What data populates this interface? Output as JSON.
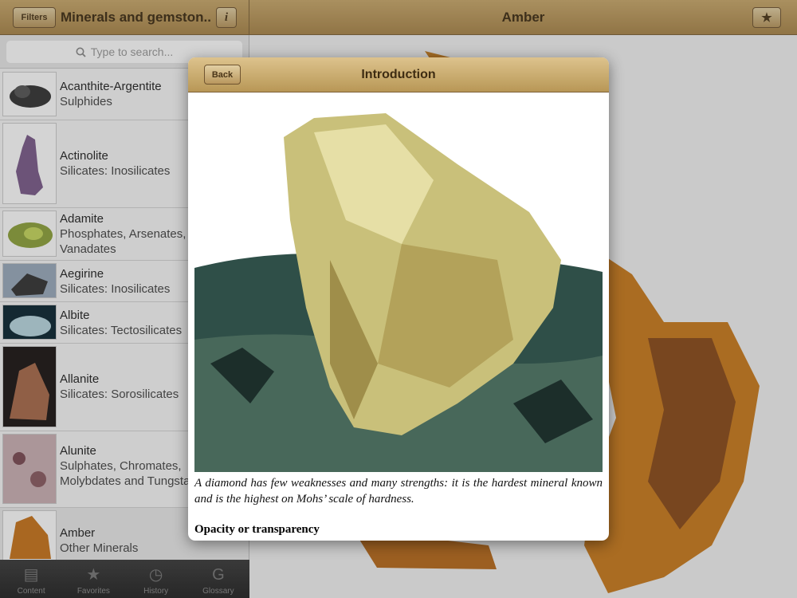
{
  "header": {
    "filters_label": "Filters",
    "list_title": "Minerals and gemston...",
    "info_label": "i",
    "detail_title": "Amber",
    "star_icon": "star-icon"
  },
  "search": {
    "placeholder": "Type to search..."
  },
  "items": [
    {
      "name": "Acanthite-Argentite",
      "group": "Sulphides"
    },
    {
      "name": "Actinolite",
      "group": "Silicates: Inosilicates"
    },
    {
      "name": "Adamite",
      "group": "Phosphates, Arsenates,",
      "group2": "Vanadates"
    },
    {
      "name": "Aegirine",
      "group": "Silicates: Inosilicates"
    },
    {
      "name": "Albite",
      "group": "Silicates: Tectosilicates"
    },
    {
      "name": "Allanite",
      "group": "Silicates: Sorosilicates"
    },
    {
      "name": "Alunite",
      "group": "Sulphates, Chromates,",
      "group2": "Molybdates and Tungstates"
    },
    {
      "name": "Amber",
      "group": "Other Minerals"
    }
  ],
  "tabs": [
    {
      "label": "Content",
      "icon": "book-icon"
    },
    {
      "label": "Favorites",
      "icon": "star-icon"
    },
    {
      "label": "History",
      "icon": "clock-icon"
    },
    {
      "label": "Glossary",
      "icon": "glossary-icon"
    }
  ],
  "modal": {
    "title": "Introduction",
    "back_label": "Back",
    "caption": "A diamond has few weaknesses and many strengths: it is the hardest mineral known and is the highest on Mohs’ scale of hardness.",
    "section_heading": "Opacity or transparency"
  }
}
